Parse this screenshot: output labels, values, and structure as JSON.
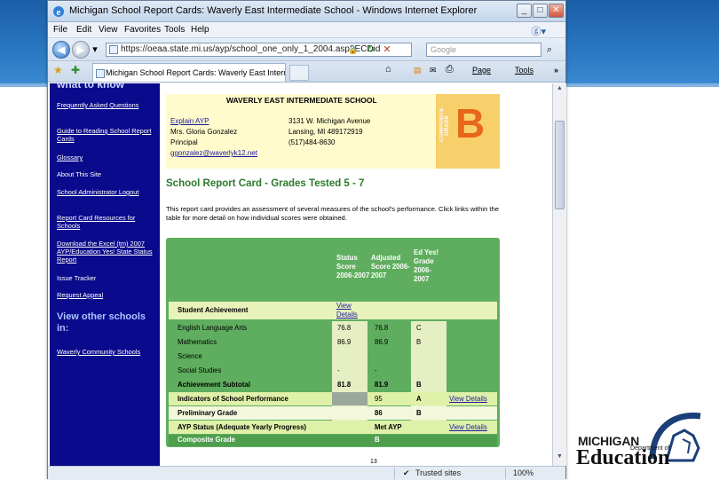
{
  "window": {
    "title": "Michigan School Report Cards: Waverly East Intermediate School - Windows Internet Explorer",
    "min_glyph": "_",
    "max_glyph": "□",
    "close_glyph": "✕"
  },
  "menu": [
    "File",
    "Edit",
    "View",
    "Favorites",
    "Tools",
    "Help"
  ],
  "address": {
    "url": "https://oeaa.state.mi.us/ayp/school_one_only_1_2004.asp?ECDid",
    "search_placeholder": "Google",
    "back_glyph": "◀",
    "forward_glyph": "▶",
    "dropdown_glyph": "▾",
    "lock_icon": "🔒",
    "refresh_glyph": "↻",
    "stop_glyph": "✕",
    "search_glyph": "⌕",
    "brand_icon": "ⓖ▾"
  },
  "tabs": {
    "active_label": "Michigan School Report Cards: Waverly East Interme...",
    "favorites_icon": "★",
    "add_favorites_icon": "✚",
    "home_icon": "⌂",
    "feeds_icon": "▤",
    "mail_icon": "✉",
    "print_icon": "⎙",
    "page_label": "Page",
    "tools_label": "Tools",
    "more_glyph": "»"
  },
  "sidebar": {
    "heading_partial": "what to know",
    "links": [
      {
        "label": "Frequently Asked Questions"
      },
      {
        "label": "Guide to Reading School Report Cards"
      },
      {
        "label": "Glossary"
      },
      {
        "label": "About This Site"
      },
      {
        "label": "School Administrator Logout"
      },
      {
        "label": "Report Card Resources for Schools"
      },
      {
        "label": "Download the Excel (tm) 2007 AYP/Education Yes! State Status Report"
      },
      {
        "label": "Issue Tracker"
      },
      {
        "label": "Request Appeal"
      }
    ],
    "view_other": "View other schools in:",
    "community_link": "Waverly Community Schools"
  },
  "school": {
    "name": "WAVERLY EAST INTERMEDIATE SCHOOL",
    "explain_link": "Explain AYP",
    "principal_name": "Mrs. Gloria Gonzalez",
    "principal_title": "Principal",
    "email": "ggonzalez@waverlyk12.net",
    "street": "3131 W. Michigan Avenue",
    "city": "Lansing, MI 489172919",
    "phone": "(517)484-8630",
    "grade_caption": "COMPOSITE GRADE",
    "grade_letter": "B"
  },
  "report": {
    "title": "School Report Card - Grades Tested 5 - 7",
    "description": "This report card provides an assessment of several measures of the school's performance. Click links within the table for more detail on how individual scores were obtained."
  },
  "table": {
    "headers": {
      "status": "Status Score 2006-2007",
      "adjusted": "Adjusted Score 2006-2007",
      "edyes": "Ed Yes! Grade 2006-2007"
    },
    "section_label": "Student Achievement",
    "view_details": "View Details",
    "rows": [
      {
        "label": "English Language Arts",
        "status": "76.8",
        "adjusted": "76.8",
        "grade": "C",
        "link": ""
      },
      {
        "label": "Mathematics",
        "status": "86.9",
        "adjusted": "86.9",
        "grade": "B",
        "link": ""
      },
      {
        "label": "Science",
        "status": "",
        "adjusted": "",
        "grade": "",
        "link": ""
      },
      {
        "label": "Social Studies",
        "status": "-",
        "adjusted": "-",
        "grade": "",
        "link": ""
      },
      {
        "label": "Achievement Subtotal",
        "status": "81.8",
        "adjusted": "81.9",
        "grade": "B",
        "link": ""
      },
      {
        "label": "Indicators of School Performance",
        "status": "",
        "adjusted": "95",
        "grade": "A",
        "link": "View Details"
      },
      {
        "label": "Preliminary Grade",
        "status": "",
        "adjusted": "86",
        "grade": "B",
        "link": ""
      },
      {
        "label": "AYP Status (Adequate Yearly Progress)",
        "status": "",
        "adjusted": "Met AYP",
        "grade": "",
        "link": "View Details"
      },
      {
        "label": "Composite Grade",
        "status": "",
        "adjusted": "B",
        "grade": "",
        "link": ""
      }
    ]
  },
  "page_number": "13",
  "status": {
    "zone": "Trusted sites",
    "zoom": "100%"
  },
  "logo": {
    "top": "MICHIGAN",
    "dept": "Department of",
    "bottom": "Education"
  }
}
